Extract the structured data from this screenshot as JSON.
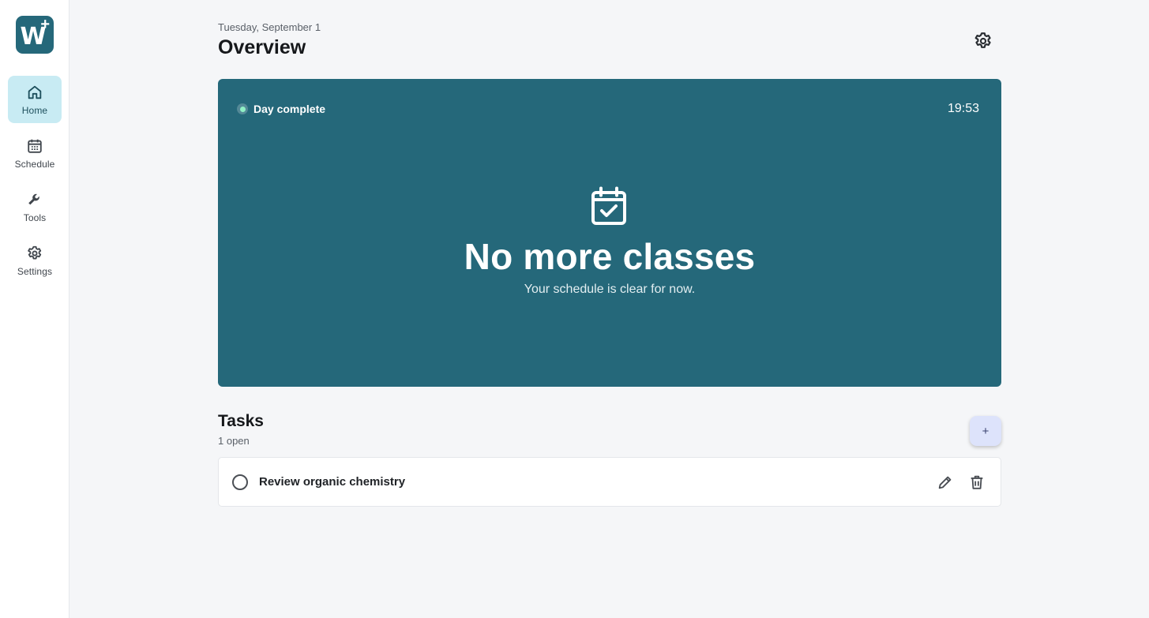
{
  "app": {
    "logo_letter": "W",
    "logo_plus": "+"
  },
  "sidebar": {
    "items": [
      {
        "label": "Home",
        "icon": "home-icon",
        "active": true
      },
      {
        "label": "Schedule",
        "icon": "calendar-icon",
        "active": false
      },
      {
        "label": "Tools",
        "icon": "wrench-icon",
        "active": false
      },
      {
        "label": "Settings",
        "icon": "gear-icon",
        "active": false
      }
    ]
  },
  "header": {
    "date": "Tuesday, September 1",
    "title": "Overview",
    "settings_icon": "gear-icon"
  },
  "hero": {
    "status": "Day complete",
    "time": "19:53",
    "icon": "calendar-check-icon",
    "title": "No more classes",
    "subtitle": "Your schedule is clear for now."
  },
  "tasks": {
    "title": "Tasks",
    "count": "1 open",
    "add_label": "+",
    "items": [
      {
        "label": "Review organic chemistry",
        "done": false
      }
    ]
  },
  "colors": {
    "accent": "#25687a",
    "active_nav": "#c8ebf3",
    "status_dot": "#8ff0c5",
    "add_button": "#dde3fb",
    "background": "#f5f6f8"
  }
}
